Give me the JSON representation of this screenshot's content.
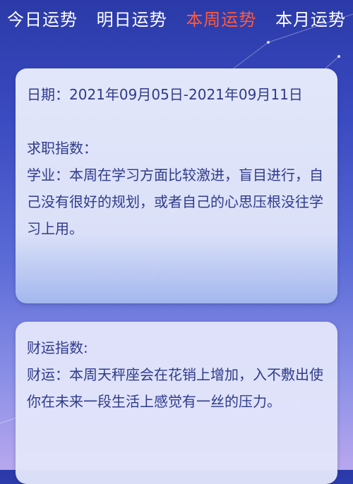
{
  "tabs": [
    {
      "label": "今日运势",
      "active": false
    },
    {
      "label": "明日运势",
      "active": false
    },
    {
      "label": "本周运势",
      "active": true
    },
    {
      "label": "本月运势",
      "active": false
    }
  ],
  "card1": {
    "date": "日期：2021年09月05日-2021年09月11日",
    "job_heading": "求职指数：",
    "study_text": "学业：本周在学习方面比较激进，盲目进行，自己没有很好的规划，或者自己的心思压根没往学习上用。"
  },
  "card2": {
    "wealth_heading": "财运指数:",
    "wealth_text": "财运：本周天秤座会在花销上增加，入不敷出使你在未来一段生活上感觉有一丝的压力。"
  },
  "colors": {
    "active_tab": "#ff5a3c",
    "tab": "#ffffff",
    "card_text": "#2f3b8a"
  }
}
